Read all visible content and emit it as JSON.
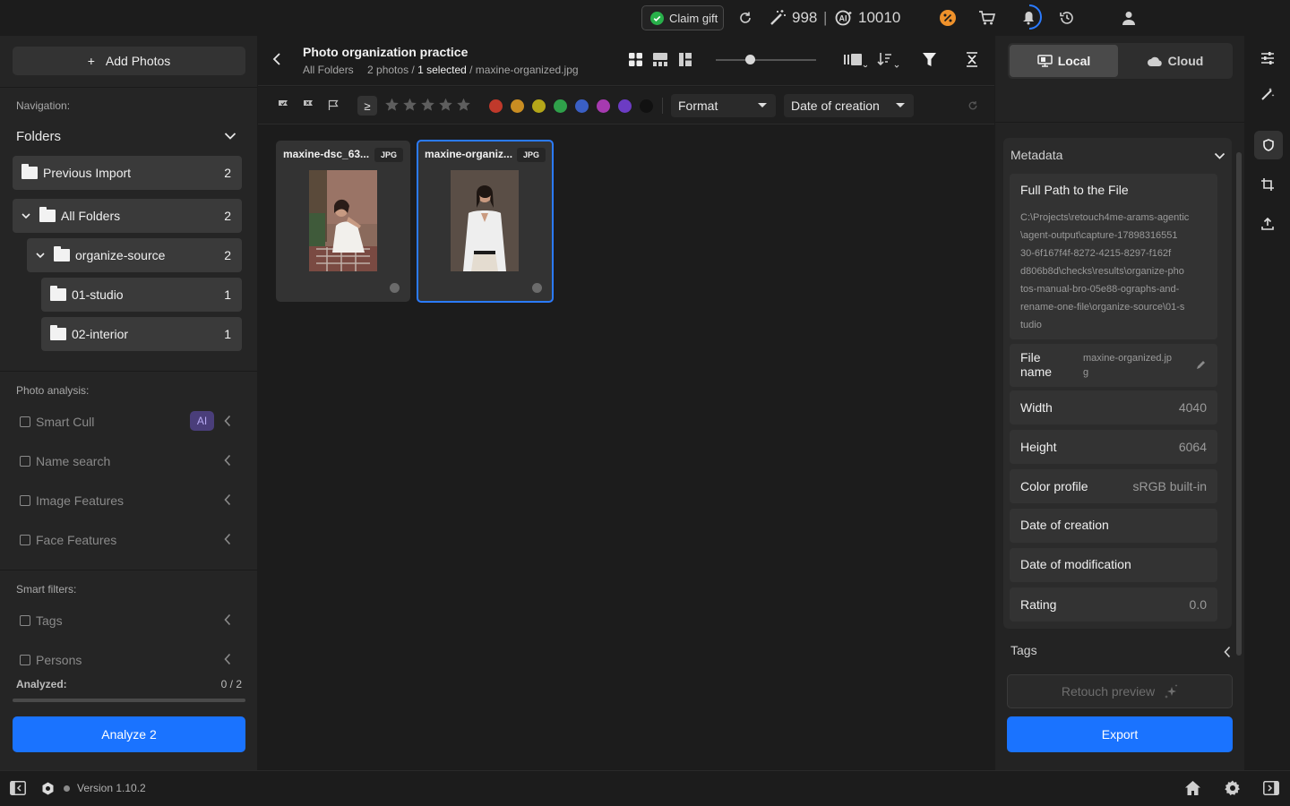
{
  "topbar": {
    "claim_gift": "Claim gift",
    "credits": "998",
    "separator": "|",
    "ai_credits": "10010"
  },
  "sidebar": {
    "add_photos": "Add Photos",
    "navigation_label": "Navigation:",
    "folders_label": "Folders",
    "previous_import": {
      "label": "Previous Import",
      "count": "2"
    },
    "all_folders": {
      "label": "All Folders",
      "count": "2"
    },
    "organize_source": {
      "label": "organize-source",
      "count": "2"
    },
    "studio": {
      "label": "01-studio",
      "count": "1"
    },
    "interior": {
      "label": "02-interior",
      "count": "1"
    },
    "photo_analysis_label": "Photo analysis:",
    "smart_cull": "Smart Cull",
    "ai_badge": "AI",
    "name_search": "Name search",
    "image_features": "Image Features",
    "face_features": "Face Features",
    "smart_filters_label": "Smart filters:",
    "tags": "Tags",
    "persons": "Persons",
    "analyzed_label": "Analyzed:",
    "analyzed_value": "0 / 2",
    "analyzed_fraction": 0,
    "analyze_button": "Analyze 2"
  },
  "header": {
    "title": "Photo organization practice",
    "crumb_folder": "All Folders",
    "crumb_photos": "2 photos /",
    "crumb_selected": "1 selected",
    "crumb_file": "/ maxine-organized.jpg"
  },
  "filters": {
    "ge_symbol": "≥",
    "format_label": "Format",
    "date_label": "Date of creation",
    "color_labels": [
      "#c0392b",
      "#c98d22",
      "#b4a619",
      "#2fa04a",
      "#3a5fc4",
      "#a63ab0",
      "#6c3cc4",
      "#111111"
    ]
  },
  "photos": [
    {
      "name": "maxine-dsc_63...",
      "format": "JPG"
    },
    {
      "name": "maxine-organiz...",
      "format": "JPG"
    }
  ],
  "right": {
    "local": "Local",
    "cloud": "Cloud",
    "metadata_title": "Metadata",
    "full_path_label": "Full Path to the File",
    "full_path_lines": [
      "C:\\Projects\\retouch4me-arams-agentic",
      "\\agent-output\\capture-17898316551",
      "30-6f167f4f-8272-4215-8297-f162f",
      "d806b8d\\checks\\results\\organize-pho",
      "tos-manual-bro-05e88-ographs-and-",
      "rename-one-file\\organize-source\\01-s",
      "tudio"
    ],
    "file_name_label_1": "File",
    "file_name_label_2": "name",
    "file_name_value_1": "maxine-organized.jp",
    "file_name_value_2": "g",
    "width_label": "Width",
    "width_value": "4040",
    "height_label": "Height",
    "height_value": "6064",
    "color_profile_label": "Color profile",
    "color_profile_value": "sRGB built-in",
    "date_creation_label": "Date of creation",
    "date_modification_label": "Date of modification",
    "rating_label": "Rating",
    "rating_value": "0.0",
    "tags_label": "Tags",
    "retouch_preview": "Retouch preview",
    "export": "Export"
  },
  "footer": {
    "version": "Version 1.10.2"
  },
  "colors": {
    "accent": "#1a73ff",
    "selected_border": "#2b7bff",
    "ai_badge": "#4a3e7a",
    "claim_check": "#28b04a"
  }
}
